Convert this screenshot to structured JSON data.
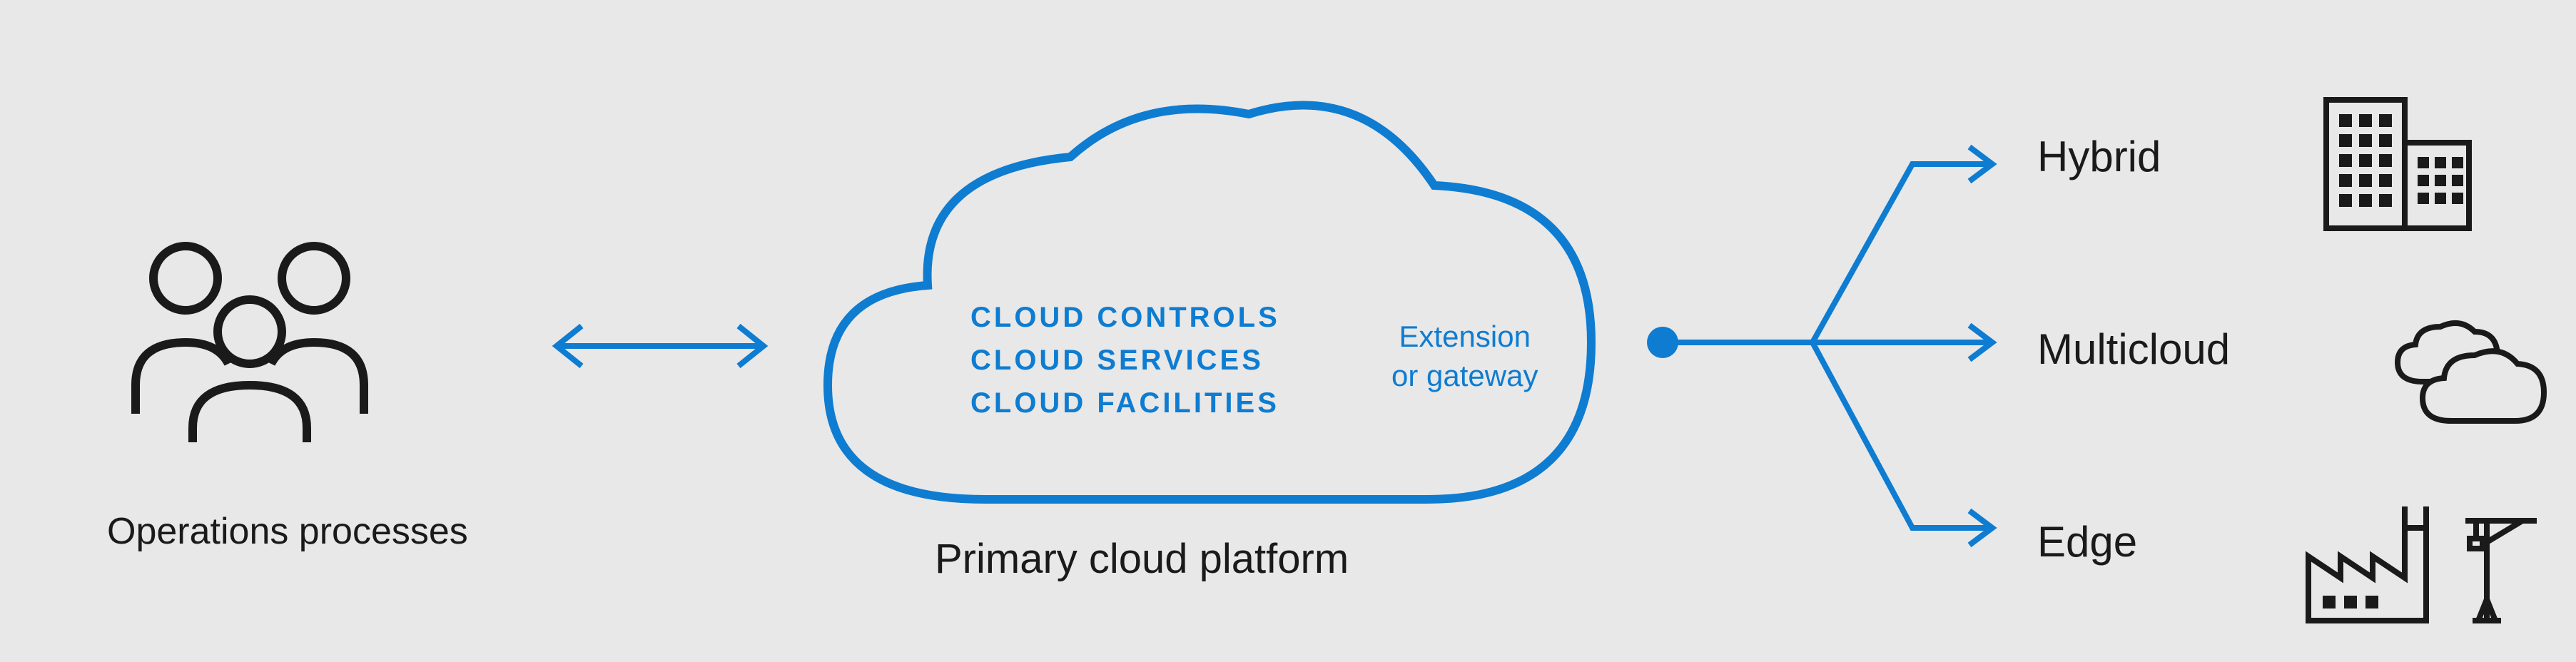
{
  "operations": {
    "label": "Operations processes"
  },
  "cloud": {
    "line1": "CLOUD CONTROLS",
    "line2": "CLOUD SERVICES",
    "line3": "CLOUD FACILITIES",
    "extension_line1": "Extension",
    "extension_line2": "or gateway",
    "label": "Primary cloud platform"
  },
  "targets": {
    "hybrid": "Hybrid",
    "multicloud": "Multicloud",
    "edge": "Edge"
  },
  "colors": {
    "blue": "#0e7cd1",
    "black": "#1a1a1a",
    "bg": "#e8e8e8"
  }
}
